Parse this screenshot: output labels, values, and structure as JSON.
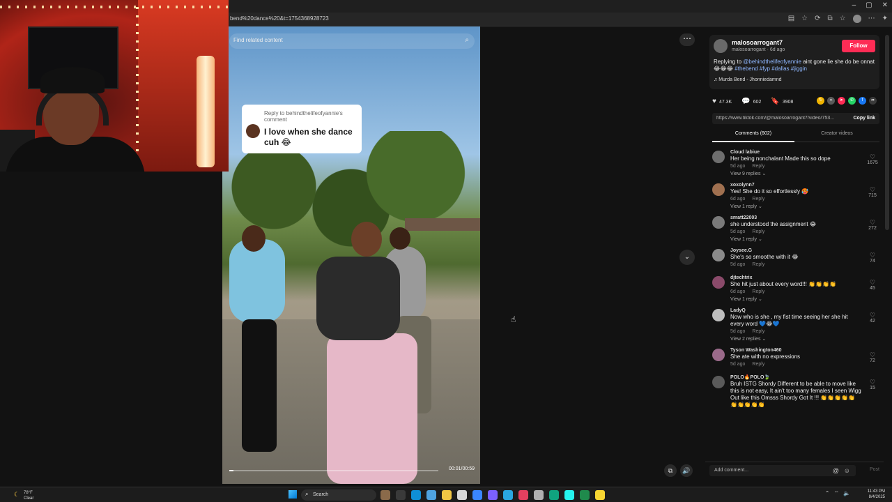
{
  "browser": {
    "url": "bend%20dance%20&t=1754368928723",
    "window_controls": [
      "–",
      "▢",
      "✕"
    ]
  },
  "video": {
    "search_placeholder": "Find related content",
    "reply_title": "Reply to behindthelifeofyannie's comment",
    "reply_text": "I love when she dance cuh 😂",
    "time": "00:01/00:59",
    "progress": 0.02
  },
  "post": {
    "username": "malosoarrogant7",
    "meta": "malosoarrogant · 6d ago",
    "follow_label": "Follow",
    "caption_prefix": "Replying to ",
    "caption_mention": "@behindthelifeofyannie",
    "caption_body": " aint gone lie she do be onnat 😂😂😂 ",
    "caption_tags": "#thebend #fyp #dallas #jiggin",
    "music": "Murda Bend - Jhonniedamnd",
    "likes": "47.3K",
    "comments_count": "602",
    "saves": "3908",
    "link": "https://www.tiktok.com/@malosoarrogant7/video/753...",
    "copy_link_label": "Copy link",
    "share_colors": [
      "#f0b400",
      "#5a5a5a",
      "#fe2c55",
      "#25d366",
      "#1877f2"
    ]
  },
  "tabs": [
    {
      "label": "Comments (602)"
    },
    {
      "label": "Creator videos"
    }
  ],
  "comments": [
    {
      "user": "Cloud labiue",
      "text": "Her being nonchalant Made this so dope",
      "age": "5d ago",
      "reply": "Reply",
      "replies": "View 9 replies ⌄",
      "likes": "1675",
      "avatar": "#6e6e6e"
    },
    {
      "user": "xoxolynn7",
      "text": "Yes! She do it so effortlessly 🥵",
      "age": "6d ago",
      "reply": "Reply",
      "replies": "View 1 reply ⌄",
      "likes": "715",
      "avatar": "#a07050"
    },
    {
      "user": "smatt22003",
      "text": "she understood the assignment 😂",
      "age": "5d ago",
      "reply": "Reply",
      "replies": "View 1 reply ⌄",
      "likes": "272",
      "avatar": "#7a7a7a"
    },
    {
      "user": "Joysee.G",
      "text": "She's so smoothe with it 😂",
      "age": "5d ago",
      "reply": "Reply",
      "replies": "",
      "likes": "74",
      "avatar": "#8a8a8a"
    },
    {
      "user": "djtechtrix",
      "text": "She hit just about every word!!! 👏👏👏👏",
      "age": "6d ago",
      "reply": "Reply",
      "replies": "View 1 reply ⌄",
      "likes": "45",
      "avatar": "#8a4a6a"
    },
    {
      "user": "LadyQ",
      "text": "Now who is she , my fist time seeing her she hit every word 💙😂💙",
      "age": "5d ago",
      "reply": "Reply",
      "replies": "View 2 replies ⌄",
      "likes": "42",
      "avatar": "#bdbdbd"
    },
    {
      "user": "Tyson Washington460",
      "text": "She ate with no expressions",
      "age": "5d ago",
      "reply": "Reply",
      "replies": "",
      "likes": "72",
      "avatar": "#9a6a8a"
    },
    {
      "user": "POLO🔥POLO🍃",
      "text": "Bruh ISTG Shordy Different to be able to move like this is not easy, It ain't too many females I seen Wigg Out like this Omsss Shordy Got It !!! 👏👏👏👏👏👏👏👏👏👏",
      "age": "",
      "reply": "",
      "replies": "",
      "likes": "15",
      "avatar": "#5a5a5a"
    }
  ],
  "add_comment": {
    "placeholder": "Add comment...",
    "post_label": "Post"
  },
  "taskbar": {
    "temp": "78°F",
    "condition": "Clear",
    "search_label": "Search",
    "time": "11:43 PM",
    "date": "8/4/2025",
    "app_colors": [
      "#8a6a4a",
      "#3a3a3a",
      "#0f8fd6",
      "#4fa3e0",
      "#f2c744",
      "#d8d8d8",
      "#3a86ff",
      "#7b61ff",
      "#2aa7e0",
      "#e4405f",
      "#b0b0b0",
      "#10a37f",
      "#25f4ee",
      "#1f8a4c",
      "#f7d532"
    ]
  }
}
